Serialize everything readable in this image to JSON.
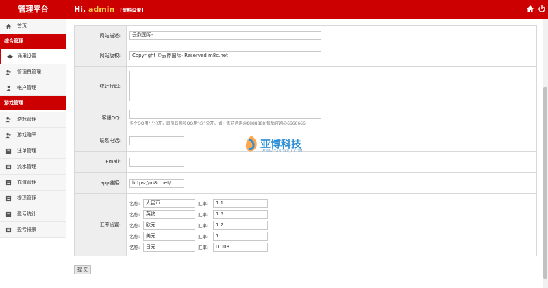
{
  "header": {
    "brand": "管理平台",
    "greeting": "Hi,",
    "username": "admin",
    "profile_link": "[资料设置]",
    "home_icon": "home-icon",
    "logout_icon": "power-icon"
  },
  "sidebar": {
    "home": "首页",
    "section1": "综合管理",
    "general_settings": "通用设置",
    "admin_mgmt": "管理员管理",
    "account_mgmt": "帐户管理",
    "section2": "游戏管理",
    "game_mgmt": "游戏管理",
    "game_odds": "游戏赔率",
    "bet_mgmt": "注单管理",
    "flow_mgmt": "流水管理",
    "recharge_mgmt": "充值管理",
    "withdraw_mgmt": "提现管理",
    "profit_stats": "盈亏统计",
    "profit_report": "盈亏报表"
  },
  "form": {
    "site_desc_label": "网站描述:",
    "site_desc_value": "云鼎国际-",
    "copyright_label": "网站版权:",
    "copyright_value": "Copyright ©云鼎国际- Reserved m8c.net",
    "stats_label": "统计代码:",
    "qq_label": "客服QQ:",
    "qq_hint": "多个QQ用“|”分开，显示名称和QQ用“@”分开，如：售前咨询@8888888|售后咨询@6666666",
    "phone_label": "联系电话:",
    "email_label": "Email:",
    "app_label": "app链接:",
    "app_value": "https://m8c.net/",
    "rates_label": "汇率设置:",
    "name_label": "名称:",
    "rate_label": "汇率:",
    "rates": [
      {
        "name": "人民币",
        "rate": "1.1"
      },
      {
        "name": "英镑",
        "rate": "1.5"
      },
      {
        "name": "欧元",
        "rate": "1.2"
      },
      {
        "name": "美元",
        "rate": "1"
      },
      {
        "name": "日元",
        "rate": "0.008"
      }
    ],
    "submit": "提 交"
  },
  "watermark": {
    "text": "亚博科技",
    "sub": "WWW.YABOKEJI.COM"
  },
  "colors": {
    "brand_red": "#cc0000",
    "label_bg": "#eeeeee"
  }
}
